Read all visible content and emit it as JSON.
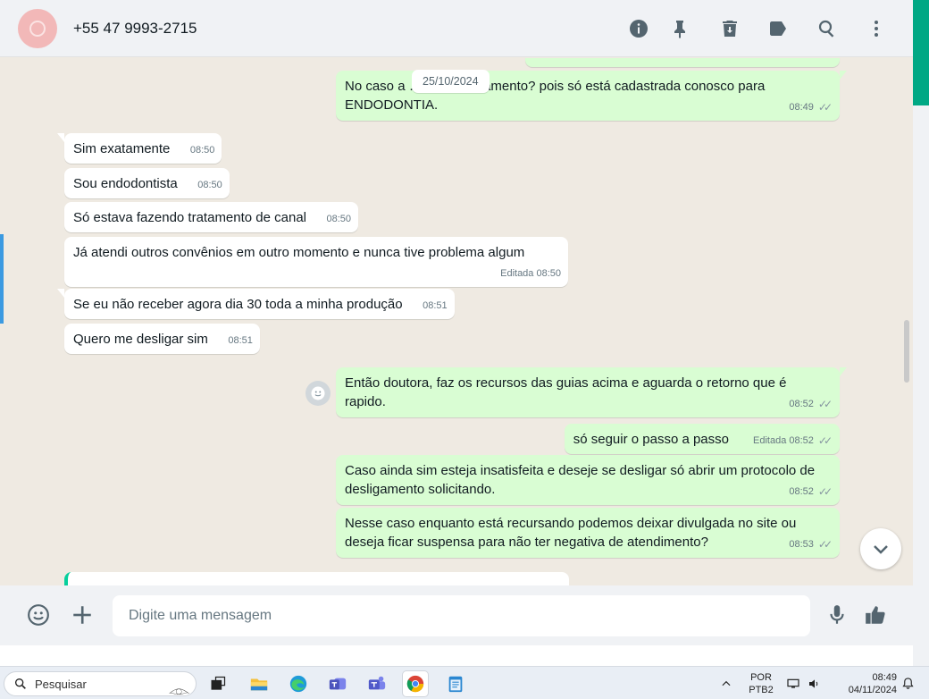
{
  "header": {
    "contact_name": "+55 47 9993-2715",
    "icons": [
      "info-icon",
      "pin-icon",
      "delete-icon",
      "label-icon",
      "search-icon",
      "more-icon"
    ]
  },
  "chat": {
    "date_label": "25/10/2024",
    "messages": [
      {
        "dir": "out",
        "text": "No caso a … a o desligamento? pois só está cadastrada conosco para ENDODONTIA.",
        "time": "08:49",
        "status": "read"
      },
      {
        "dir": "in",
        "text": "Sim exatamente",
        "time": "08:50"
      },
      {
        "dir": "in",
        "text": "Sou endodontista",
        "time": "08:50"
      },
      {
        "dir": "in",
        "text": "Só estava fazendo tratamento de canal",
        "time": "08:50"
      },
      {
        "dir": "in",
        "text": "Já atendi outros convênios em outro momento e nunca tive problema algum",
        "time": "Editada 08:50"
      },
      {
        "dir": "in",
        "text": "Se eu não receber agora dia 30 toda a minha produção",
        "time": "08:51"
      },
      {
        "dir": "in",
        "text": "Quero me desligar sim",
        "time": "08:51"
      },
      {
        "dir": "out",
        "text": "Então doutora, faz os recursos das guias acima e aguarda o retorno que é rapido.",
        "time": "08:52",
        "status": "read"
      },
      {
        "dir": "out",
        "text": "só seguir o passo a passo",
        "time": "Editada 08:52",
        "status": "read"
      },
      {
        "dir": "out",
        "text": "Caso ainda sim esteja insatisfeita e deseje se desligar só abrir um protocolo de desligamento solicitando.",
        "time": "08:52",
        "status": "read"
      },
      {
        "dir": "out",
        "text": "Nesse caso enquanto está recursando podemos deixar divulgada no site ou deseja ficar suspensa para não ter negativa de atendimento?",
        "time": "08:53",
        "status": "read"
      }
    ]
  },
  "composer": {
    "placeholder": "Digite uma mensagem"
  },
  "taskbar": {
    "search_label": "Pesquisar",
    "language_line1": "POR",
    "language_line2": "PTB2",
    "time": "08:49",
    "date": "04/11/2024"
  },
  "colors": {
    "outgoing_bubble": "#d9fdd3",
    "incoming_bubble": "#ffffff",
    "chat_background": "#efeae2",
    "accent": "#00a884"
  }
}
